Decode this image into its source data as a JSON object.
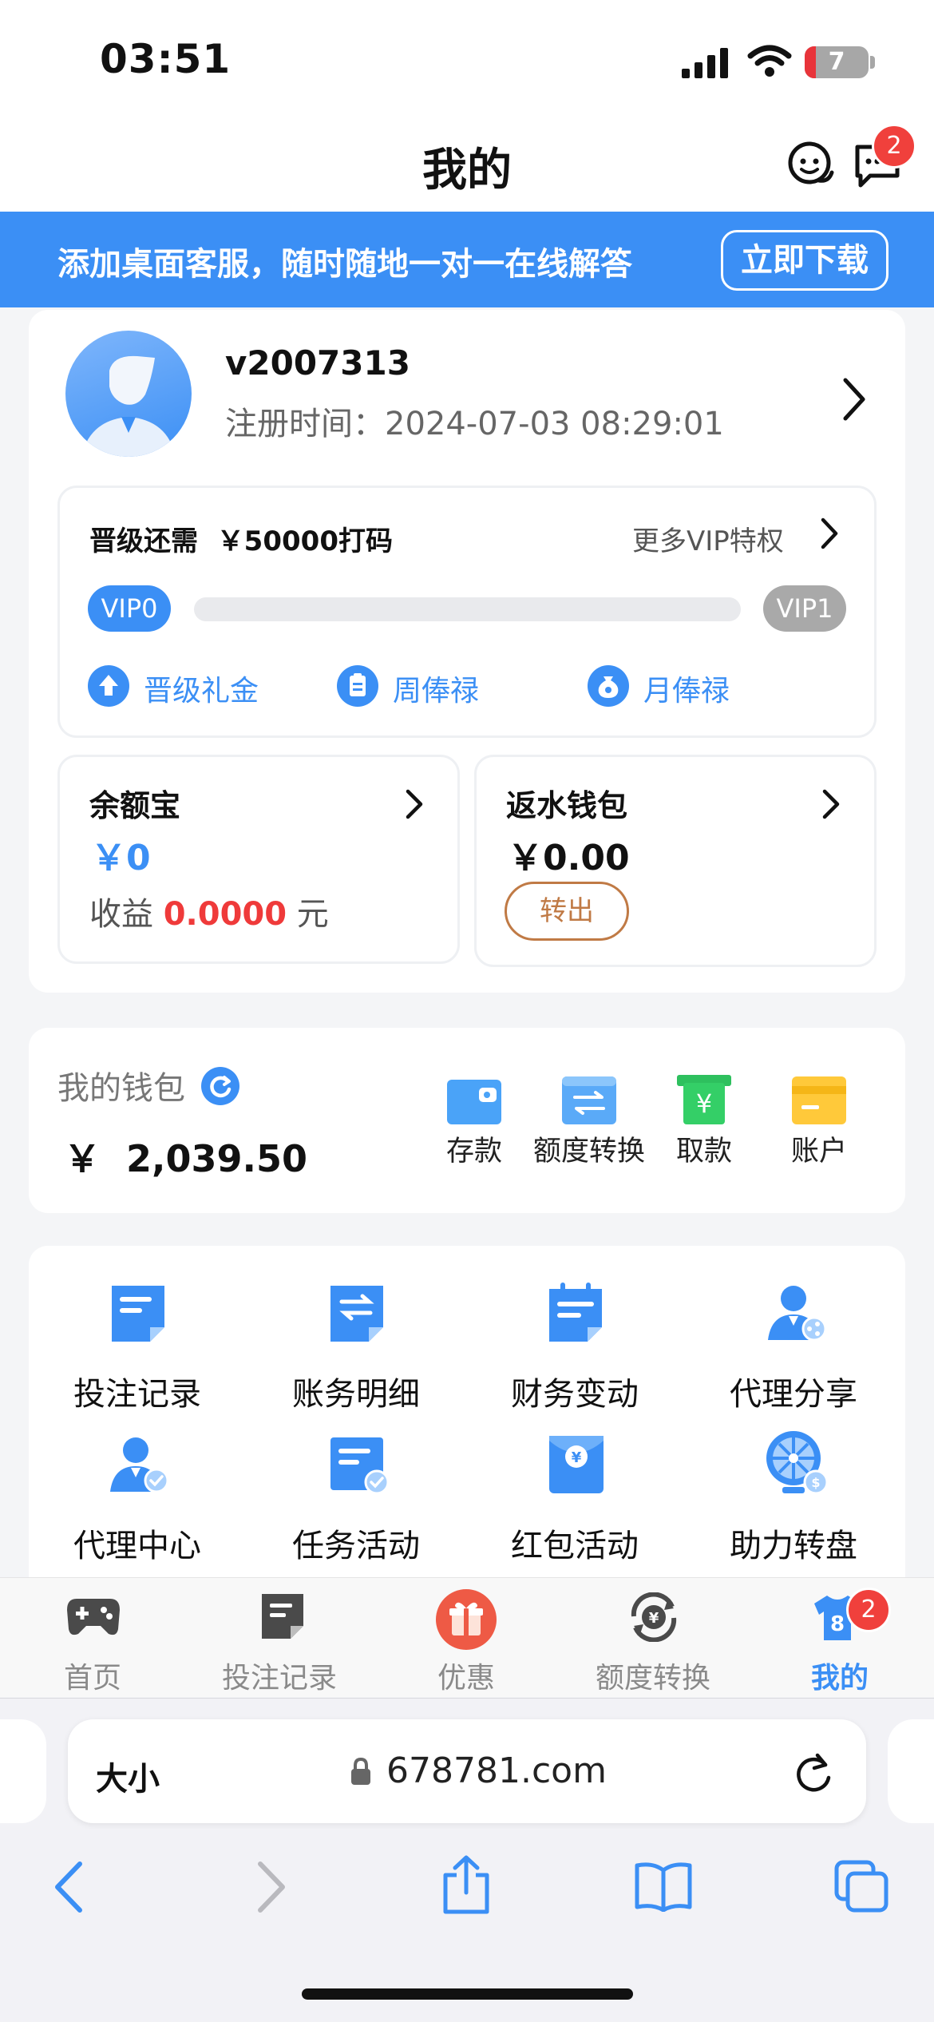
{
  "status_bar": {
    "time": "03:51",
    "battery": "7"
  },
  "header": {
    "title": "我的",
    "message_badge": "2",
    "icons": [
      "customer-service-icon",
      "chat-icon"
    ]
  },
  "banner": {
    "text": "添加桌面客服，随时随地一对一在线解答",
    "button": "立即下载"
  },
  "profile": {
    "username": "v2007313",
    "reg_label": "注册时间：",
    "reg_time": "2024-07-03 08:29:01"
  },
  "vip": {
    "need_label": "晋级还需",
    "need_value": "￥50000打码",
    "more": "更多VIP特权",
    "current": "VIP0",
    "next": "VIP1",
    "progress": 0,
    "perks": [
      "晋级礼金",
      "周俸禄",
      "月俸禄"
    ]
  },
  "yuebao": {
    "title": "余额宝",
    "amount": "￥0",
    "income_label": "收益",
    "income_value": "0.0000",
    "income_unit": "元"
  },
  "rebate": {
    "title": "返水钱包",
    "amount": "￥0.00",
    "button": "转出"
  },
  "wallet": {
    "title": "我的钱包",
    "balance": "￥  2,039.50",
    "actions": [
      "存款",
      "额度转换",
      "取款",
      "账户"
    ]
  },
  "grid": {
    "items": [
      "投注记录",
      "账务明细",
      "财务变动",
      "代理分享",
      "代理中心",
      "任务活动",
      "红包活动",
      "助力转盘"
    ]
  },
  "tabbar": {
    "items": [
      "首页",
      "投注记录",
      "优惠",
      "额度转换",
      "我的"
    ],
    "active": "我的",
    "mine_badge": "2",
    "accent": "#3b8ff5"
  },
  "safari": {
    "aa": "大小",
    "url": "678781.com"
  }
}
